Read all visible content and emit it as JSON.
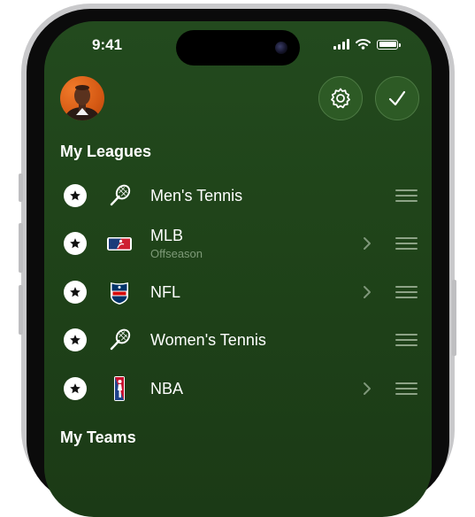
{
  "status_bar": {
    "time": "9:41"
  },
  "header": {
    "avatar": "avatar",
    "settings_icon": "gear-icon",
    "done_icon": "checkmark-icon"
  },
  "sections": {
    "my_leagues": "My Leagues",
    "my_teams": "My Teams"
  },
  "leagues": [
    {
      "name": "Men's Tennis",
      "subtitle": "",
      "logo": "tennis-racket-icon",
      "has_chevron": false
    },
    {
      "name": "MLB",
      "subtitle": "Offseason",
      "logo": "mlb-logo",
      "has_chevron": true
    },
    {
      "name": "NFL",
      "subtitle": "",
      "logo": "nfl-logo",
      "has_chevron": true
    },
    {
      "name": "Women's Tennis",
      "subtitle": "",
      "logo": "tennis-racket-icon",
      "has_chevron": false
    },
    {
      "name": "NBA",
      "subtitle": "",
      "logo": "nba-logo",
      "has_chevron": true
    }
  ],
  "colors": {
    "background": "#1f4319",
    "accent": "#2d5a25",
    "text": "#ffffff",
    "secondary": "#7e9a78"
  }
}
